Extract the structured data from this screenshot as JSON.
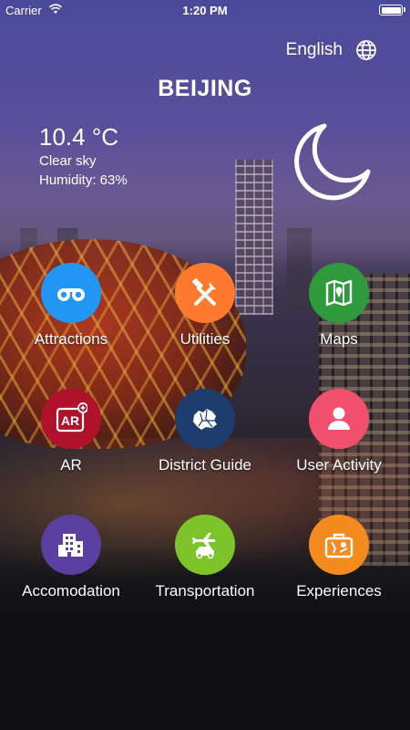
{
  "status_bar": {
    "carrier": "Carrier",
    "time": "1:20 PM"
  },
  "header": {
    "language": "English",
    "city": "BEIJING"
  },
  "weather": {
    "temperature": "10.4 °C",
    "condition": "Clear sky",
    "humidity": "Humidity: 63%",
    "icon": "moon-icon"
  },
  "menu": [
    {
      "label": "Attractions",
      "icon": "binoculars-icon",
      "color": "#2196f3"
    },
    {
      "label": "Utilities",
      "icon": "tools-icon",
      "color": "#ff7a2f"
    },
    {
      "label": "Maps",
      "icon": "map-icon",
      "color": "#2e9a3c"
    },
    {
      "label": "AR",
      "icon": "ar-icon",
      "color": "#b0122b"
    },
    {
      "label": "District Guide",
      "icon": "district-map-icon",
      "color": "#1c3d6e"
    },
    {
      "label": "User Activity",
      "icon": "user-icon",
      "color": "#f0506e"
    },
    {
      "label": "Accomodation",
      "icon": "building-icon",
      "color": "#5a3fa0"
    },
    {
      "label": "Transportation",
      "icon": "plane-car-icon",
      "color": "#7cc42a"
    },
    {
      "label": "Experiences",
      "icon": "suitcase-icon",
      "color": "#f58a1f"
    }
  ]
}
